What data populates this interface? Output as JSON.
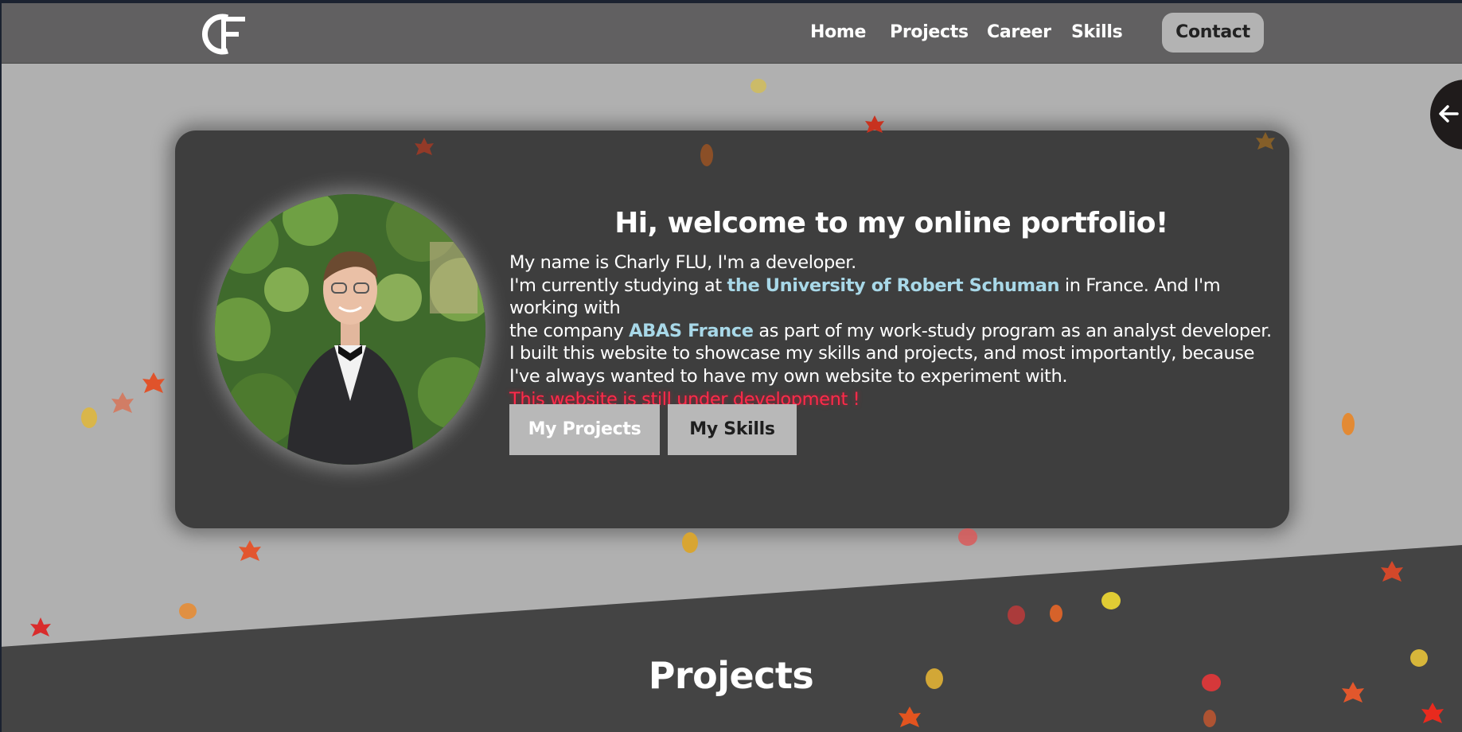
{
  "nav": {
    "logo_text": "CF",
    "links": [
      "Home",
      "Projects",
      "Career",
      "Skills"
    ],
    "contact_label": "Contact"
  },
  "hero": {
    "title": "Hi, welcome to my online portfolio!",
    "line1": "My name is Charly FLU, I'm a developer.",
    "line2_pre": "I'm currently studying at ",
    "university": "the University of Robert Schuman",
    "line2_post": " in France. And I'm working with",
    "line3_pre": "the company ",
    "company": "ABAS France",
    "line3_post": " as part of my work-study program as an analyst developer.",
    "line4": "I built this website to showcase my skills and projects, and most importantly, because",
    "line5": "I've always wanted to have my own website to experiment with.",
    "warning": "This website is still under development !",
    "btn_projects": "My Projects",
    "btn_skills": "My Skills"
  },
  "projects_section": {
    "title": "Projects"
  },
  "side_toggle": {
    "icon": "arrow-left-icon"
  },
  "colors": {
    "navbar": "#616061",
    "background": "#b0b0b0",
    "card": "#3e3e3e",
    "dark_band": "#444444",
    "link_highlight": "#a8d8e8",
    "warning": "#ff2a4a",
    "button": "#b8b8b8"
  }
}
